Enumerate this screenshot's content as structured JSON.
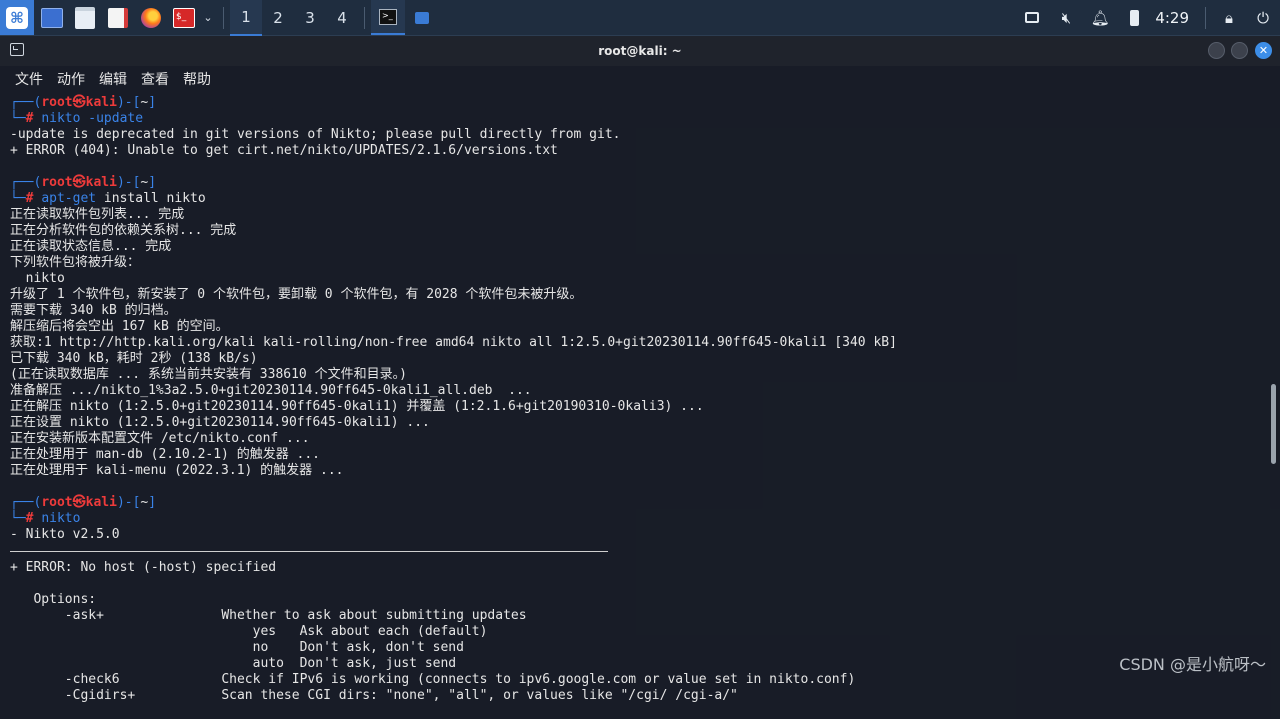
{
  "taskbar": {
    "workspaces": [
      "1",
      "2",
      "3",
      "4"
    ],
    "active_workspace": "1",
    "clock": "4:29",
    "icons": [
      "kali-menu-icon",
      "desktop-icon",
      "file-manager-icon",
      "text-editor-icon",
      "firefox-icon",
      "terminal-icon",
      "terminal-window-icon",
      "files-window-icon"
    ],
    "tray_icons": [
      "display-icon",
      "mute-icon",
      "bell-icon",
      "battery-icon",
      "lock-icon",
      "power-icon"
    ]
  },
  "window": {
    "title": "root@kali: ~",
    "menu": [
      "文件",
      "动作",
      "编辑",
      "查看",
      "帮助"
    ]
  },
  "terminal": {
    "prompt": {
      "open": "┌──(",
      "user": "root㉿kali",
      "close": ")-[",
      "dir": "~",
      "end": "]",
      "second": "└─",
      "hash": "# "
    },
    "blocks": [
      {
        "cmd_first": "nikto",
        "cmd_rest": " -update",
        "cmd_all_blue": true,
        "output": [
          "-update is deprecated in git versions of Nikto; please pull directly from git.",
          "+ ERROR (404): Unable to get cirt.net/nikto/UPDATES/2.1.6/versions.txt"
        ]
      },
      {
        "cmd_first": "apt-get",
        "cmd_rest": " install nikto",
        "cmd_all_blue": false,
        "output": [
          "正在读取软件包列表... 完成",
          "正在分析软件包的依赖关系树... 完成",
          "正在读取状态信息... 完成",
          "下列软件包将被升级：",
          "  nikto",
          "升级了 1 个软件包，新安装了 0 个软件包，要卸载 0 个软件包，有 2028 个软件包未被升级。",
          "需要下载 340 kB 的归档。",
          "解压缩后将会空出 167 kB 的空间。",
          "获取:1 http://http.kali.org/kali kali-rolling/non-free amd64 nikto all 1:2.5.0+git20230114.90ff645-0kali1 [340 kB]",
          "已下载 340 kB，耗时 2秒 (138 kB/s)",
          "(正在读取数据库 ... 系统当前共安装有 338610 个文件和目录。)",
          "准备解压 .../nikto_1%3a2.5.0+git20230114.90ff645-0kali1_all.deb  ...",
          "正在解压 nikto (1:2.5.0+git20230114.90ff645-0kali1) 并覆盖 (1:2.1.6+git20190310-0kali3) ...",
          "正在设置 nikto (1:2.5.0+git20230114.90ff645-0kali1) ...",
          "正在安装新版本配置文件 /etc/nikto.conf ...",
          "正在处理用于 man-db (2.10.2-1) 的触发器 ...",
          "正在处理用于 kali-menu (2022.3.1) 的触发器 ..."
        ]
      },
      {
        "cmd_first": "nikto",
        "cmd_rest": "",
        "cmd_all_blue": true,
        "output": [
          "- Nikto v2.5.0"
        ]
      }
    ],
    "after_rule": [
      "+ ERROR: No host (-host) specified",
      "",
      "   Options:",
      "       -ask+               Whether to ask about submitting updates",
      "                               yes   Ask about each (default)",
      "                               no    Don't ask, don't send",
      "                               auto  Don't ask, just send",
      "       -check6             Check if IPv6 is working (connects to ipv6.google.com or value set in nikto.conf)",
      "       -Cgidirs+           Scan these CGI dirs: \"none\", \"all\", or values like \"/cgi/ /cgi-a/\""
    ]
  },
  "watermark": "CSDN @是小航呀～"
}
